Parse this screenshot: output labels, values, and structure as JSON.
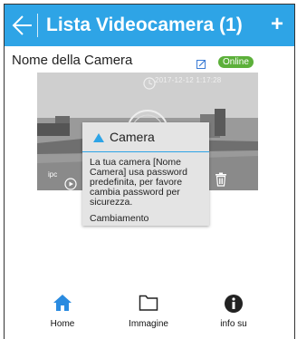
{
  "header": {
    "title": "Lista Videocamera (1)",
    "add_label": "+"
  },
  "camera": {
    "name": "Nome della Camera",
    "status": "Online",
    "timestamp": "2017-12-12 1:17:28",
    "overlay_label": "ipc"
  },
  "popup": {
    "title": "Camera",
    "message": "La tua camera [Nome Camera] usa password predefinita, per favore cambia password per sicurezza.",
    "action": "Cambiamento"
  },
  "tabs": [
    {
      "label": "Home",
      "icon": "home-icon",
      "active": true
    },
    {
      "label": "Immagine",
      "icon": "folder-icon",
      "active": false
    },
    {
      "label": "info su",
      "icon": "info-icon",
      "active": false
    }
  ],
  "colors": {
    "accent": "#2ea4e6",
    "online": "#5cb03a",
    "tab_active": "#2a8be0"
  }
}
